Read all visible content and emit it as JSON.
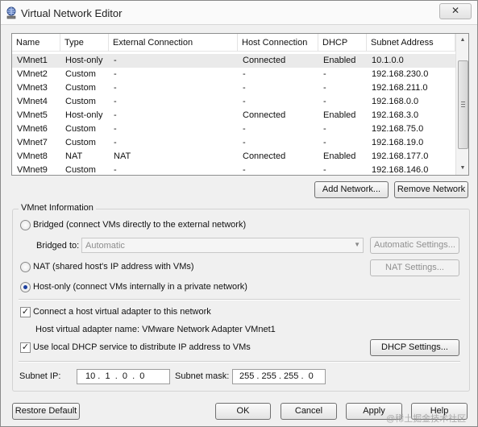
{
  "window": {
    "title": "Virtual Network Editor",
    "close_glyph": "✕"
  },
  "table": {
    "headers": [
      "Name",
      "Type",
      "External Connection",
      "Host Connection",
      "DHCP",
      "Subnet Address"
    ],
    "rows": [
      [
        "VMnet1",
        "Host-only",
        "-",
        "Connected",
        "Enabled",
        "10.1.0.0"
      ],
      [
        "VMnet2",
        "Custom",
        "-",
        "-",
        "-",
        "192.168.230.0"
      ],
      [
        "VMnet3",
        "Custom",
        "-",
        "-",
        "-",
        "192.168.211.0"
      ],
      [
        "VMnet4",
        "Custom",
        "-",
        "-",
        "-",
        "192.168.0.0"
      ],
      [
        "VMnet5",
        "Host-only",
        "-",
        "Connected",
        "Enabled",
        "192.168.3.0"
      ],
      [
        "VMnet6",
        "Custom",
        "-",
        "-",
        "-",
        "192.168.75.0"
      ],
      [
        "VMnet7",
        "Custom",
        "-",
        "-",
        "-",
        "192.168.19.0"
      ],
      [
        "VMnet8",
        "NAT",
        "NAT",
        "Connected",
        "Enabled",
        "192.168.177.0"
      ],
      [
        "VMnet9",
        "Custom",
        "-",
        "-",
        "-",
        "192.168.146.0"
      ]
    ],
    "selected_row": 0
  },
  "list_buttons": {
    "add": "Add Network...",
    "remove": "Remove Network"
  },
  "vmnet_info": {
    "group_label": "VMnet Information",
    "bridged_label": "Bridged (connect VMs directly to the external network)",
    "bridged_to_label": "Bridged to:",
    "bridged_to_value": "Automatic",
    "auto_settings": "Automatic Settings...",
    "nat_label": "NAT (shared host's IP address with VMs)",
    "nat_settings": "NAT Settings...",
    "hostonly_label": "Host-only (connect VMs internally in a private network)",
    "selected_mode": "host-only",
    "connect_adapter_label": "Connect a host virtual adapter to this network",
    "connect_adapter_checked": true,
    "adapter_name_label": "Host virtual adapter name: VMware Network Adapter VMnet1",
    "dhcp_label": "Use local DHCP service to distribute IP address to VMs",
    "dhcp_checked": true,
    "dhcp_settings": "DHCP Settings...",
    "subnet_ip_label": "Subnet IP:",
    "subnet_ip_value": "10 .  1  .  0  .  0",
    "subnet_mask_label": "Subnet mask:",
    "subnet_mask_value": "255 . 255 . 255 .  0"
  },
  "footer": {
    "restore_default": "Restore Default",
    "ok": "OK",
    "cancel": "Cancel",
    "apply": "Apply",
    "help": "Help"
  },
  "watermark": "@稀土掘金技术社区",
  "icons": {
    "app": "network-globe-icon",
    "check": "✓",
    "scroll_up": "▲",
    "scroll_down": "▼",
    "combo_arrow": "▼"
  }
}
